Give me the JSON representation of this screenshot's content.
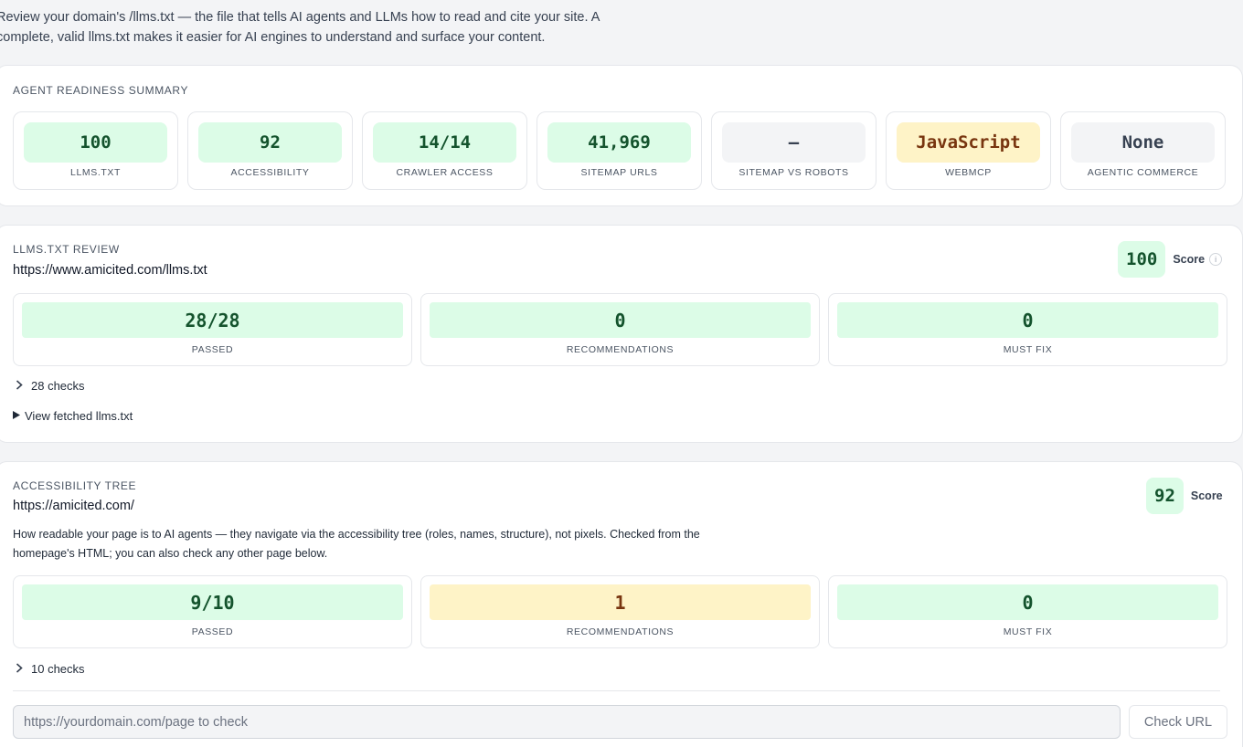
{
  "intro": {
    "line1": "Review your domain's /llms.txt — the file that tells AI agents and LLMs how to read and cite your site. A",
    "line2": "complete, valid llms.txt makes it easier for AI engines to understand and surface your content."
  },
  "summary": {
    "title": "AGENT READINESS SUMMARY",
    "tiles": [
      {
        "value": "100",
        "label": "LLMS.TXT",
        "tone": "green"
      },
      {
        "value": "92",
        "label": "ACCESSIBILITY",
        "tone": "green"
      },
      {
        "value": "14/14",
        "label": "CRAWLER ACCESS",
        "tone": "green"
      },
      {
        "value": "41,969",
        "label": "SITEMAP URLS",
        "tone": "green"
      },
      {
        "value": "–",
        "label": "SITEMAP VS ROBOTS",
        "tone": "gray"
      },
      {
        "value": "JavaScript",
        "label": "WEBMCP",
        "tone": "amber"
      },
      {
        "value": "None",
        "label": "AGENTIC COMMERCE",
        "tone": "gray"
      }
    ]
  },
  "llms_review": {
    "title": "LLMS.TXT REVIEW",
    "url": "https://www.amicited.com/llms.txt",
    "score": "100",
    "score_label": "Score",
    "info_glyph": "i",
    "results": [
      {
        "value": "28/28",
        "label": "PASSED",
        "tone": "green"
      },
      {
        "value": "0",
        "label": "RECOMMENDATIONS",
        "tone": "green"
      },
      {
        "value": "0",
        "label": "MUST FIX",
        "tone": "green"
      }
    ],
    "checks_label": "28 checks",
    "fetched_label": "View fetched llms.txt"
  },
  "accessibility": {
    "title": "ACCESSIBILITY TREE",
    "url": "https://amicited.com/",
    "score": "92",
    "score_label": "Score",
    "description_line1": "How readable your page is to AI agents — they navigate via the accessibility tree (roles, names, structure), not pixels. Checked from the",
    "description_line2": "homepage's HTML; you can also check any other page below.",
    "results": [
      {
        "value": "9/10",
        "label": "PASSED",
        "tone": "green"
      },
      {
        "value": "1",
        "label": "RECOMMENDATIONS",
        "tone": "amber"
      },
      {
        "value": "0",
        "label": "MUST FIX",
        "tone": "green"
      }
    ],
    "checks_label": "10 checks",
    "input_placeholder": "https://yourdomain.com/page to check",
    "check_button": "Check URL"
  },
  "colors": {
    "green_bg": "#dcfce7",
    "amber_bg": "#fef3c7",
    "gray_bg": "#f3f4f6"
  }
}
